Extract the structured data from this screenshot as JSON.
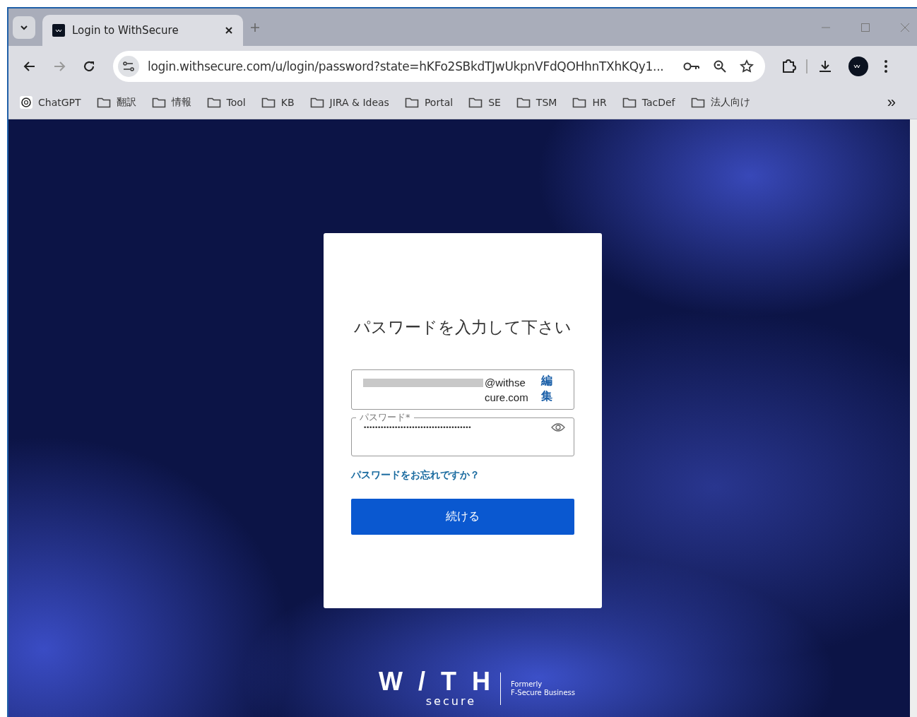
{
  "tabs": [
    {
      "title": "Login to WithSecure",
      "selected": true
    }
  ],
  "address_bar": {
    "url": "login.withsecure.com/u/login/password?state=hKFo2SBkdTJwUkpnVFdQOHhnTXhKQy1..."
  },
  "bookmarks": [
    {
      "label": "ChatGPT",
      "kind": "site"
    },
    {
      "label": "翻訳",
      "kind": "folder"
    },
    {
      "label": "情報",
      "kind": "folder"
    },
    {
      "label": "Tool",
      "kind": "folder"
    },
    {
      "label": "KB",
      "kind": "folder"
    },
    {
      "label": "JIRA & Ideas",
      "kind": "folder"
    },
    {
      "label": "Portal",
      "kind": "folder"
    },
    {
      "label": "SE",
      "kind": "folder"
    },
    {
      "label": "TSM",
      "kind": "folder"
    },
    {
      "label": "HR",
      "kind": "folder"
    },
    {
      "label": "TacDef",
      "kind": "folder"
    },
    {
      "label": "法人向け",
      "kind": "folder"
    }
  ],
  "overflow": "»",
  "login": {
    "heading": "パスワードを入力して下さい",
    "email": "@withsecure.com",
    "edit_link": "編集",
    "password_label": "パスワード*",
    "password_value": "••••••••••••••••••••••••••••••••••••••",
    "forgot_link": "パスワードをお忘れですか？",
    "continue_button": "続ける"
  },
  "logo": {
    "word": "W/TH",
    "sub": "secure",
    "tagline_1": "Formerly",
    "tagline_2": "F-Secure Business"
  }
}
